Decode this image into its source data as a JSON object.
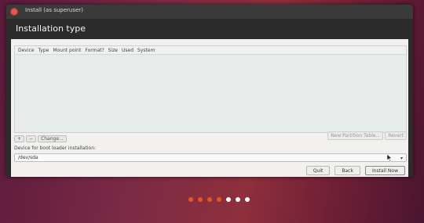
{
  "window": {
    "title": "Install (as superuser)",
    "heading": "Installation type"
  },
  "table": {
    "columns": [
      "Device",
      "Type",
      "Mount point",
      "Format?",
      "Size",
      "Used",
      "System"
    ]
  },
  "partition_toolbar": {
    "add_label": "+",
    "remove_label": "−",
    "change_label": "Change...",
    "new_table_label": "New Partition Table...",
    "revert_label": "Revert"
  },
  "bootloader": {
    "label": "Device for boot loader installation:",
    "selected": "/dev/sda"
  },
  "buttons": {
    "quit": "Quit",
    "back": "Back",
    "install": "Install Now"
  },
  "progress_dots": {
    "colors": [
      "#e95420",
      "#e95420",
      "#e95420",
      "#e95420",
      "#ffffff",
      "#ffffff",
      "#ffffff"
    ]
  },
  "colors": {
    "accent": "#e95420",
    "close": "#e4574a"
  }
}
